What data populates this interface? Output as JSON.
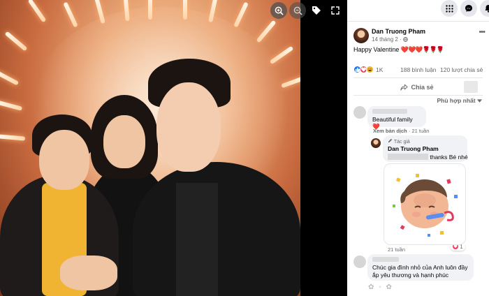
{
  "viewer": {
    "tools": [
      "zoom-in-icon",
      "zoom-out-icon",
      "tag-icon",
      "expand-icon"
    ]
  },
  "topbar": {
    "icons": [
      "grid-menu-icon",
      "messenger-icon",
      "bell-icon"
    ]
  },
  "post": {
    "author": "Dan Truong Pham",
    "date": "14 tháng 2 · ",
    "caption_text": "Happy Valentine ",
    "caption_emoji": "❤️❤️❤️🌹🌹🌹",
    "reaction_count": "1K",
    "comment_count": "188 bình luận",
    "share_count": "120 lượt chia sẻ",
    "share_label": "Chia sẻ",
    "sort_label": "Phù hợp nhất",
    "colors": {
      "like": "#1877f2",
      "love": "#f33e58",
      "haha": "#f7b125"
    }
  },
  "comments": [
    {
      "text": "Beautiful family ❤️",
      "translate": "Xem bản dịch",
      "time": "21 tuần"
    },
    {
      "author_badge": "Tác giả",
      "author": "Dan Truong Pham",
      "text": " thanks Bé nhé",
      "time": "21 tuần",
      "like_count": "1"
    },
    {
      "text": "Chúc gia đình nhỏ của Anh luôn đầy ắp yêu thương và hạnh phúc"
    }
  ]
}
